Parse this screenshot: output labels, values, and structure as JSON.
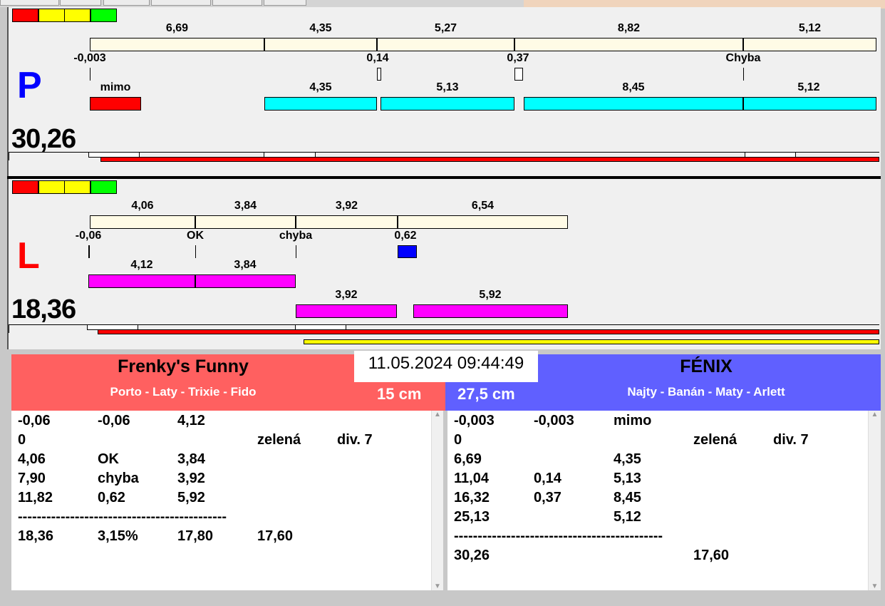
{
  "colors": {
    "red": "#ff0000",
    "yellow": "#ffff00",
    "green": "#00ff00",
    "cream": "#fffbe6",
    "cyan": "#00ffff",
    "magenta": "#ff00ff",
    "blue": "#0000ff",
    "team_left": "#ff6060",
    "team_right": "#6060ff"
  },
  "status_lights": [
    "red",
    "yellow",
    "yellow",
    "green"
  ],
  "panel_p": {
    "letter": "P",
    "total": "30,26",
    "top_segments": [
      "6,69",
      "4,35",
      "5,27",
      "8,82",
      "5,12"
    ],
    "mid_labels": [
      "-0,003",
      "0,14",
      "0,37",
      "Chyba"
    ],
    "lower_labels": [
      "mimo",
      "4,35",
      "5,13",
      "8,45",
      "5,12"
    ]
  },
  "panel_l": {
    "letter": "L",
    "total": "18,36",
    "top_segments": [
      "4,06",
      "3,84",
      "3,92",
      "6,54"
    ],
    "mid_labels": [
      "-0,06",
      "OK",
      "chyba",
      "0,62"
    ],
    "lower_labels": [
      "4,12",
      "3,84",
      "3,92",
      "5,92"
    ]
  },
  "datetime": "11.05.2024 09:44:49",
  "left_team": {
    "name": "Frenky's Funny",
    "dogs": "Porto - Laty - Trixie - Fido",
    "height": "15 cm",
    "rows": [
      [
        "-0,06",
        "-0,06",
        "4,12",
        "",
        ""
      ],
      [
        "0",
        "",
        "",
        "zelená",
        "div. 7"
      ],
      [
        "4,06",
        "OK",
        "3,84",
        "",
        ""
      ],
      [
        "7,90",
        "chyba",
        "3,92",
        "",
        ""
      ],
      [
        "11,82",
        "0,62",
        "5,92",
        "",
        ""
      ],
      [
        "--------------------------------------------",
        "",
        "",
        "",
        ""
      ],
      [
        "18,36",
        "3,15%",
        "17,80",
        "17,60",
        ""
      ]
    ]
  },
  "right_team": {
    "name": "FÉNIX",
    "dogs": "Najty - Banán - Maty - Arlett",
    "height": "27,5 cm",
    "rows": [
      [
        "-0,003",
        "-0,003",
        "mimo",
        "",
        ""
      ],
      [
        "0",
        "",
        "",
        "zelená",
        "div. 7"
      ],
      [
        "6,69",
        "",
        "4,35",
        "",
        ""
      ],
      [
        "11,04",
        "0,14",
        "5,13",
        "",
        ""
      ],
      [
        "16,32",
        "0,37",
        "8,45",
        "",
        ""
      ],
      [
        "25,13",
        "",
        "5,12",
        "",
        ""
      ],
      [
        "--------------------------------------------",
        "",
        "",
        "",
        ""
      ],
      [
        "30,26",
        "",
        "",
        "17,60",
        ""
      ]
    ]
  }
}
